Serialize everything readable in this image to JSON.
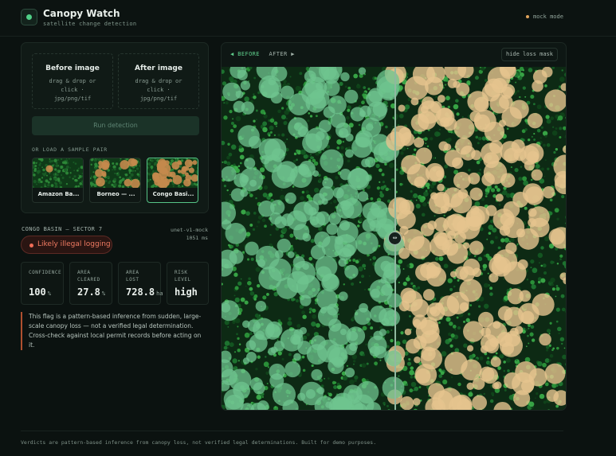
{
  "header": {
    "title": "Canopy Watch",
    "subtitle": "satellite change detection",
    "mode": "mock mode"
  },
  "upload": {
    "before": {
      "title": "Before image",
      "hint": "drag & drop or click · jpg/png/tif"
    },
    "after": {
      "title": "After image",
      "hint": "drag & drop or click · jpg/png/tif"
    },
    "run_label": "Run detection",
    "samples_label": "OR LOAD A SAMPLE PAIR",
    "samples": [
      {
        "label": "Amazon Ba...",
        "active": false
      },
      {
        "label": "Borneo — ...",
        "active": false
      },
      {
        "label": "Congo Basi...",
        "active": true
      }
    ]
  },
  "result": {
    "region": "CONGO BASIN — SECTOR 7",
    "model": "unet-v1-mock",
    "latency": "1051 ms",
    "verdict": "Likely illegal logging",
    "stats": [
      {
        "label": "CONFIDENCE",
        "value": "100",
        "unit": "%"
      },
      {
        "label": "AREA CLEARED",
        "value": "27.8",
        "unit": "%"
      },
      {
        "label": "AREA LOST",
        "value": "728.8",
        "unit": "ha"
      },
      {
        "label": "RISK LEVEL",
        "value": "high",
        "unit": ""
      }
    ],
    "note": "This flag is a pattern-based inference from sudden, large-scale canopy loss — not a verified legal determination. Cross-check against local permit records before acting on it."
  },
  "viewer": {
    "tab_before": "◀ BEFORE",
    "tab_after": "AFTER ▶",
    "mask_button": "hide loss mask",
    "handle_glyph": "⇔",
    "split_fraction": 0.5
  },
  "footer": "Verdicts are pattern-based inference from canopy loss, not verified legal determinations. Built for demo purposes.",
  "colors": {
    "accent": "#4fcf86",
    "alert": "#ef6c57",
    "forest": "#1f7a32",
    "mask_green": "#6fc48f",
    "mask_tan": "#e6c48f"
  }
}
